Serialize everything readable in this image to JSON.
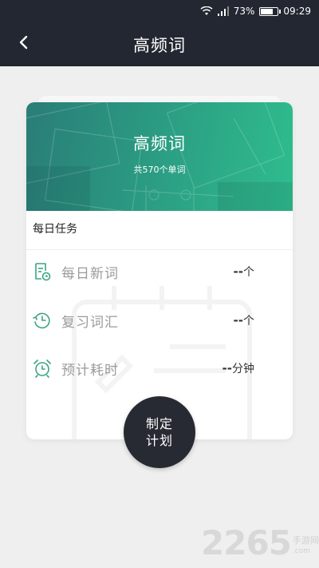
{
  "status_bar": {
    "battery_percent": "73%",
    "battery_level": 0.73,
    "time": "09:29",
    "icons": [
      "wifi-icon",
      "signal-icon",
      "battery-icon"
    ]
  },
  "nav": {
    "title": "高频词",
    "back_icon": "chevron-left-icon"
  },
  "banner": {
    "title": "高频词",
    "subtitle": "共570个单词"
  },
  "daily_task": {
    "label": "每日任务",
    "rows": [
      {
        "icon": "new-word-doc-icon",
        "label": "每日新词",
        "value": "--",
        "unit": "个"
      },
      {
        "icon": "clock-history-icon",
        "label": "复习词汇",
        "value": "--",
        "unit": "个"
      },
      {
        "icon": "alarm-clock-icon",
        "label": "预计耗时",
        "value": "--",
        "unit": "分钟"
      }
    ]
  },
  "plan_button": {
    "line1": "制定",
    "line2": "计划"
  },
  "watermark": {
    "number": "2265",
    "text": "手游网",
    "suffix": ".com"
  },
  "colors": {
    "nav_bg": "#232731",
    "banner_start": "#2a7d77",
    "banner_end": "#2fbd8d",
    "icon_green": "#3aa57e",
    "plan_button_bg": "#272a33"
  }
}
